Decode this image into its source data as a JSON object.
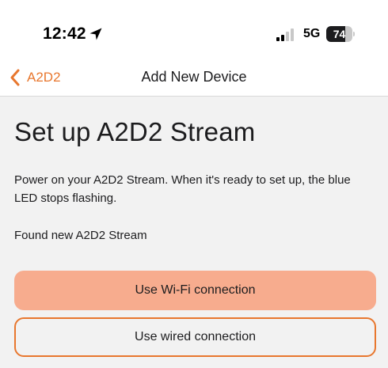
{
  "status_bar": {
    "time": "12:42",
    "network": "5G",
    "battery_percent": "74",
    "battery_level": 0.74
  },
  "nav": {
    "back_label": "A2D2",
    "title": "Add New Device"
  },
  "content": {
    "title": "Set up A2D2 Stream",
    "instructions": "Power on your A2D2 Stream. When it's ready to set up, the blue LED stops flashing.",
    "found_text": "Found new A2D2 Stream",
    "wifi_button_label": "Use Wi-Fi connection",
    "wired_button_label": "Use wired connection"
  },
  "colors": {
    "accent": "#e8772e",
    "primary_button": "#f7ac8e",
    "background": "#f2f2f2"
  },
  "icons": [
    "location-arrow-icon",
    "signal-bars-icon",
    "battery-icon",
    "chevron-left-icon"
  ]
}
